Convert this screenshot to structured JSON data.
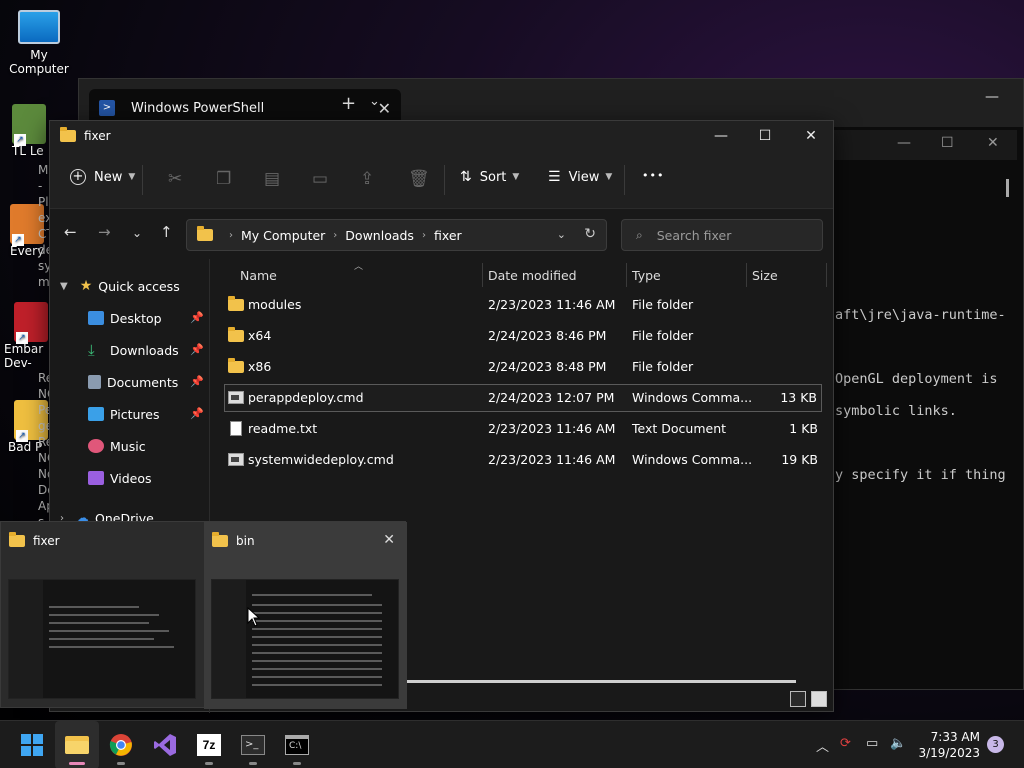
{
  "desktop": {
    "icons": [
      {
        "label": "My Computer"
      },
      {
        "label": "TL Le"
      },
      {
        "label": "Every"
      },
      {
        "label": "Embar Dev-"
      },
      {
        "label": "Bad P"
      }
    ]
  },
  "terminal": {
    "tab_title": "Windows PowerShell",
    "lines": [
      "aft\\jre\\java-runtime-",
      "OpenGL deployment is",
      "symbolic links.",
      "y specify it if thing"
    ],
    "left_chars": [
      "Me",
      "-",
      "Pl",
      "ex",
      "CT",
      "de",
      "sy",
      "ma",
      "Re",
      "NC",
      "Pe",
      "ge",
      "Re",
      "NC",
      "No",
      "Do",
      "Ap",
      "s",
      "NC"
    ]
  },
  "explorer": {
    "title": "fixer",
    "toolbar": {
      "new_label": "New",
      "sort_label": "Sort",
      "view_label": "View",
      "more_label": "•••"
    },
    "breadcrumb": [
      "My Computer",
      "Downloads",
      "fixer"
    ],
    "search_placeholder": "Search fixer",
    "sidebar": {
      "quick_access": "Quick access",
      "items": [
        {
          "label": "Desktop",
          "pinned": true,
          "color": "#3b8ee0"
        },
        {
          "label": "Downloads",
          "pinned": true,
          "color": "#3cc07a"
        },
        {
          "label": "Documents",
          "pinned": true,
          "color": "#8a9bb0"
        },
        {
          "label": "Pictures",
          "pinned": true,
          "color": "#3aa0e8"
        },
        {
          "label": "Music",
          "pinned": false,
          "color": "#e0577a"
        },
        {
          "label": "Videos",
          "pinned": false,
          "color": "#9a5fe0"
        }
      ],
      "onedrive": "OneDrive"
    },
    "columns": {
      "name": "Name",
      "date": "Date modified",
      "type": "Type",
      "size": "Size"
    },
    "files": [
      {
        "name": "modules",
        "date": "2/23/2023 11:46 AM",
        "type": "File folder",
        "size": "",
        "kind": "folder"
      },
      {
        "name": "x64",
        "date": "2/24/2023 8:46 PM",
        "type": "File folder",
        "size": "",
        "kind": "folder"
      },
      {
        "name": "x86",
        "date": "2/24/2023 8:48 PM",
        "type": "File folder",
        "size": "",
        "kind": "folder"
      },
      {
        "name": "perappdeploy.cmd",
        "date": "2/24/2023 12:07 PM",
        "type": "Windows Comma...",
        "size": "13 KB",
        "kind": "cmd"
      },
      {
        "name": "readme.txt",
        "date": "2/23/2023 11:46 AM",
        "type": "Text Document",
        "size": "1 KB",
        "kind": "txt"
      },
      {
        "name": "systemwidedeploy.cmd",
        "date": "2/23/2023 11:46 AM",
        "type": "Windows Comma...",
        "size": "19 KB",
        "kind": "cmd"
      }
    ]
  },
  "thumbnails": [
    {
      "title": "fixer"
    },
    {
      "title": "bin"
    }
  ],
  "taskbar": {
    "time": "7:33 AM",
    "date": "3/19/2023",
    "notifications": "3",
    "apps": [
      "start",
      "file-explorer",
      "chrome",
      "visual-studio",
      "7zip",
      "terminal",
      "powershell"
    ]
  }
}
